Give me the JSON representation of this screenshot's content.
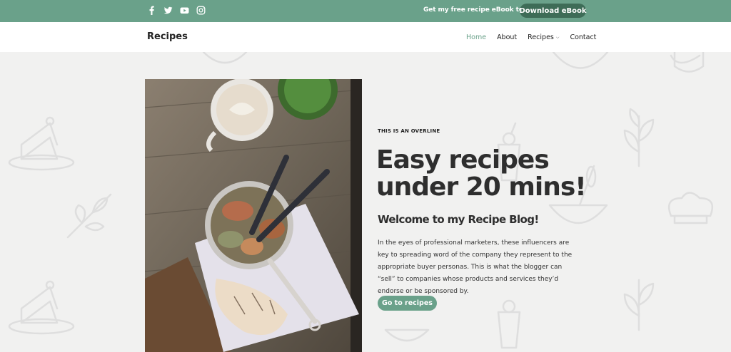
{
  "topbar": {
    "social_icons": [
      "facebook-icon",
      "twitter-icon",
      "youtube-icon",
      "instagram-icon"
    ],
    "promo_text": "Get my free recipe eBook today!",
    "download_label": "Download eBook"
  },
  "nav": {
    "brand": "Recipes",
    "items": [
      {
        "label": "Home",
        "active": true
      },
      {
        "label": "About",
        "active": false
      },
      {
        "label": "Recipes",
        "active": false,
        "dropdown": true
      },
      {
        "label": "Contact",
        "active": false
      }
    ]
  },
  "hero": {
    "image_alt_icon": "food-photo",
    "overline": "THIS IS AN OVERLINE",
    "headline": "Easy recipes under 20 mins!",
    "subheading": "Welcome to my Recipe Blog!",
    "body": "In the eyes of professional marketers, these influencers are key to spreading word of the company they represent to the appropriate buyer personas. This is what the blogger can “sell” to companies whose products and services they’d endorse or be sponsored by.",
    "cta_label": "Go to recipes"
  },
  "colors": {
    "accent": "#6aa18a",
    "accent_dark": "#3e6c57",
    "background": "#f1f1f0"
  }
}
